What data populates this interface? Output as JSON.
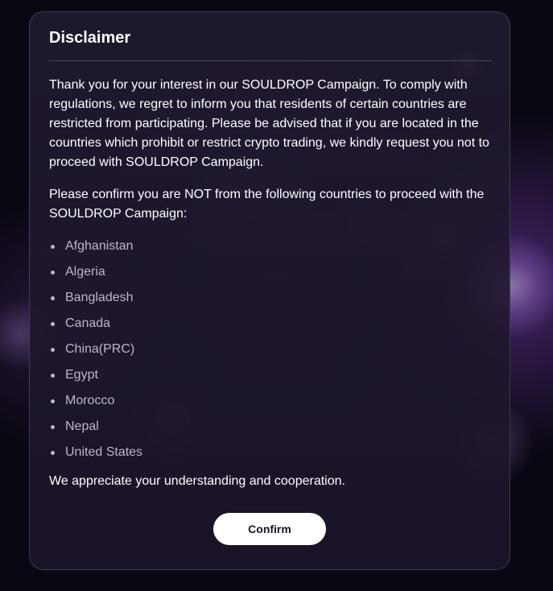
{
  "disclaimer": {
    "title": "Disclaimer",
    "intro": "Thank you for your interest in our SOULDROP Campaign. To comply with regulations, we regret to inform you that residents of certain countries are restricted from participating. Please be advised that if you are located in the countries which prohibit or restrict crypto trading, we kindly request you not to proceed with SOULDROP Campaign.",
    "confirm_prompt": "Please confirm you are NOT from the following countries to proceed with the SOULDROP Campaign:",
    "countries": [
      "Afghanistan",
      "Algeria",
      "Bangladesh",
      "Canada",
      "China(PRC)",
      "Egypt",
      "Morocco",
      "Nepal",
      "United States"
    ],
    "closing": "We appreciate your understanding and cooperation.",
    "confirm_label": "Confirm"
  },
  "colors": {
    "background": "#0b0712",
    "modal": "#211a30",
    "button": "#ffffff",
    "button_text": "#1a1425",
    "list_text": "#bdb7c6"
  }
}
